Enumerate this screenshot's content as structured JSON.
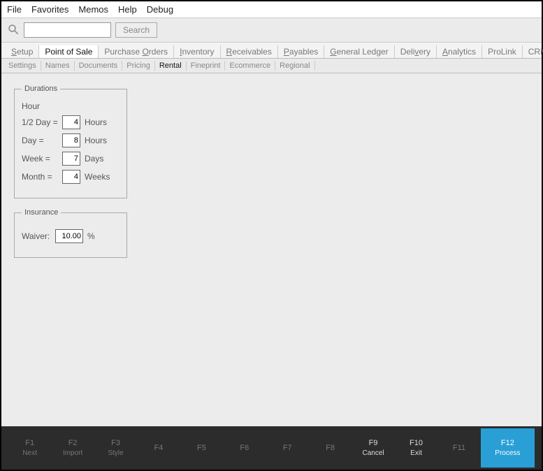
{
  "menubar": [
    "File",
    "Favorites",
    "Memos",
    "Help",
    "Debug"
  ],
  "search": {
    "button": "Search"
  },
  "tabs": [
    "Setup",
    "Point of Sale",
    "Purchase Orders",
    "Inventory",
    "Receivables",
    "Payables",
    "General Ledger",
    "Delivery",
    "Analytics",
    "ProLink",
    "CRM"
  ],
  "tabs_active": 1,
  "tabs_underline": {
    "0": 0,
    "2": 9,
    "3": 0,
    "4": 0,
    "5": 0,
    "6": 0,
    "7": 4,
    "8": 0
  },
  "subtabs": [
    "Settings",
    "Names",
    "Documents",
    "Pricing",
    "Rental",
    "Fineprint",
    "Ecommerce",
    "Regional"
  ],
  "subtabs_active": 4,
  "durations": {
    "legend": "Durations",
    "hour_label": "Hour",
    "rows": [
      {
        "label": "1/2 Day =",
        "value": "4",
        "unit": "Hours"
      },
      {
        "label": "Day =",
        "value": "8",
        "unit": "Hours"
      },
      {
        "label": "Week =",
        "value": "7",
        "unit": "Days"
      },
      {
        "label": "Month =",
        "value": "4",
        "unit": "Weeks"
      }
    ]
  },
  "insurance": {
    "legend": "Insurance",
    "label": "Waiver:",
    "value": "10.00",
    "unit": "%"
  },
  "footer": [
    {
      "fn": "F1",
      "label": "Next",
      "style": "dim"
    },
    {
      "fn": "F2",
      "label": "Import",
      "style": "dim"
    },
    {
      "fn": "F3",
      "label": "Style",
      "style": "dim"
    },
    {
      "fn": "F4",
      "label": "",
      "style": "dim"
    },
    {
      "fn": "F5",
      "label": "",
      "style": "dim"
    },
    {
      "fn": "F6",
      "label": "",
      "style": "dim"
    },
    {
      "fn": "F7",
      "label": "",
      "style": "dim"
    },
    {
      "fn": "F8",
      "label": "",
      "style": "dim"
    },
    {
      "fn": "F9",
      "label": "Cancel",
      "style": "light"
    },
    {
      "fn": "F10",
      "label": "Exit",
      "style": "light"
    },
    {
      "fn": "F11",
      "label": "",
      "style": "dim"
    },
    {
      "fn": "F12",
      "label": "Process",
      "style": "blue"
    }
  ]
}
